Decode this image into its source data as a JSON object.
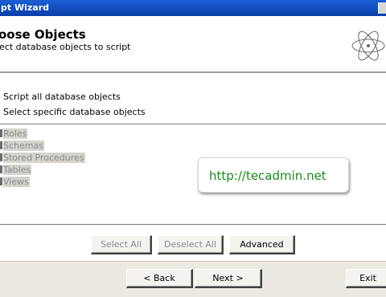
{
  "window": {
    "title": "pt Wizard"
  },
  "header": {
    "title": "oose Objects",
    "subtitle": "lect database objects to script"
  },
  "options": [
    {
      "label": "Script all database objects"
    },
    {
      "label": "Select specific database objects"
    }
  ],
  "object_list": [
    {
      "label": "Roles"
    },
    {
      "label": "Schemas"
    },
    {
      "label": "Stored Procedures"
    },
    {
      "label": "Tables"
    },
    {
      "label": "Views"
    }
  ],
  "watermark": {
    "text": "http://tecadmin.net"
  },
  "list_buttons": {
    "select_all": "Select All",
    "deselect_all": "Deselect All",
    "advanced": "Advanced"
  },
  "nav_buttons": {
    "back": "< Back",
    "next": "Next >",
    "exit": "Exit"
  },
  "colors": {
    "titlebar": "#0a3ea8",
    "watermark_text": "#1a8a1a",
    "footer": "#ece9e2"
  }
}
